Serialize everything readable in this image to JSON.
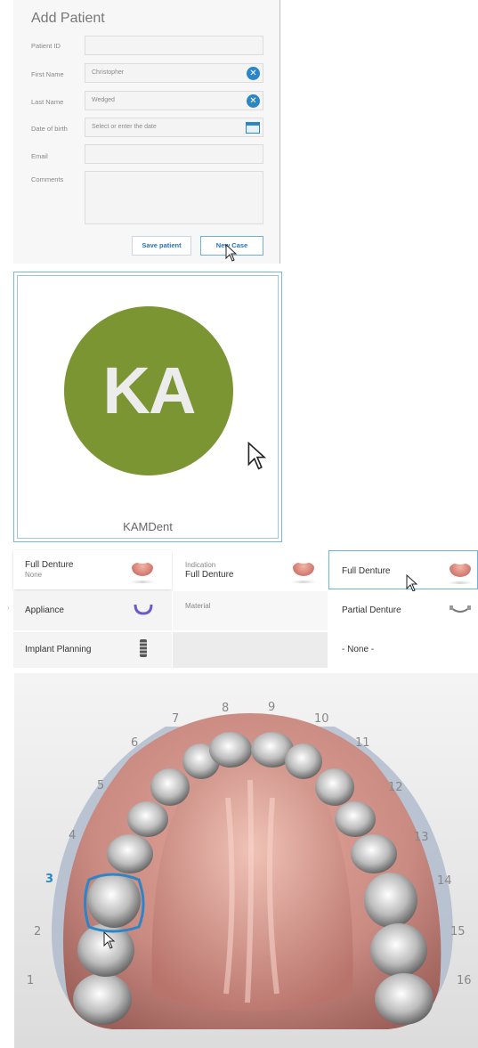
{
  "add_patient": {
    "title": "Add Patient",
    "fields": [
      {
        "label": "Patient ID",
        "value": "",
        "placeholder": ""
      },
      {
        "label": "First Name",
        "value": "Christopher"
      },
      {
        "label": "Last Name",
        "value": "Wedged"
      },
      {
        "label": "Date of birth",
        "value": "",
        "placeholder": "Select or enter the date"
      },
      {
        "label": "Email",
        "value": ""
      },
      {
        "label": "Comments",
        "value": ""
      }
    ],
    "save_button": "Save patient",
    "new_case_button": "New Case"
  },
  "lab": {
    "logo_text": "KA",
    "name": "KAMDent"
  },
  "indications": {
    "selected": {
      "label": "Full Denture",
      "sub": "None"
    },
    "indication_header": {
      "label": "Indication",
      "value": "Full Denture"
    },
    "material_label": "Material",
    "left_items": [
      "Appliance",
      "Implant Planning"
    ],
    "right_items": [
      "Full Denture",
      "Partial Denture",
      "- None -"
    ]
  },
  "jaw": {
    "selected_tooth": "3",
    "tooth_numbers": [
      "1",
      "2",
      "3",
      "4",
      "5",
      "6",
      "7",
      "8",
      "9",
      "10",
      "11",
      "12",
      "13",
      "14",
      "15",
      "16"
    ],
    "colors": {
      "gum": "#c98b82",
      "selected_outline": "#2b86c8",
      "selected_number": "#2b86c8"
    }
  }
}
